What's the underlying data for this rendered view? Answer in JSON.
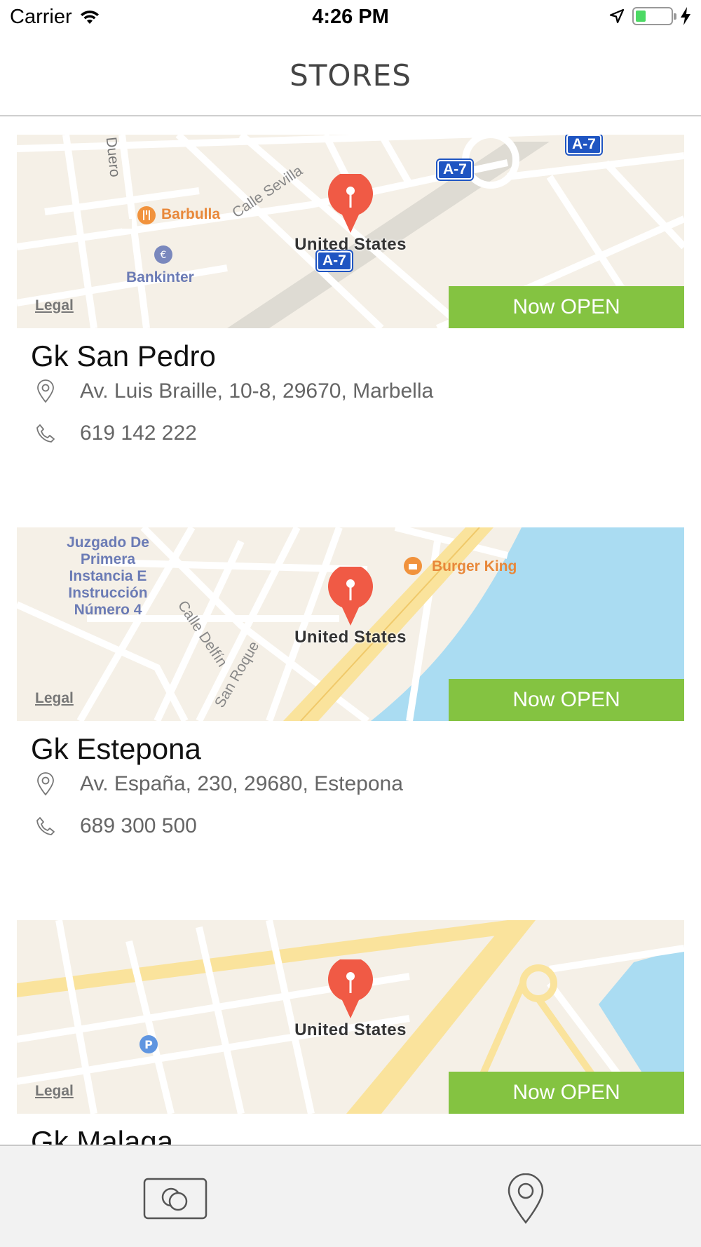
{
  "status_bar": {
    "carrier": "Carrier",
    "time": "4:26 PM"
  },
  "header": {
    "title": "STORES"
  },
  "colors": {
    "badge": "#84c341",
    "pin": "#f05a45",
    "water": "#aadcf2",
    "map_bg": "#f5f0e7"
  },
  "stores": [
    {
      "name": "Gk San Pedro",
      "address": "Av. Luis Braille, 10-8, 29670, Marbella",
      "phone": "619 142 222",
      "status": "Now OPEN",
      "map": {
        "pin_label": "United States",
        "legal": "Legal",
        "pois": [
          "Barbulla",
          "Bankinter",
          "Calle Sevilla",
          "Duero",
          "A-7",
          "A-7",
          "A-7"
        ]
      }
    },
    {
      "name": "Gk Estepona",
      "address": "Av. España, 230, 29680, Estepona",
      "phone": "689 300 500",
      "status": "Now OPEN",
      "map": {
        "pin_label": "United States",
        "legal": "Legal",
        "pois": [
          "Burger King",
          "Juzgado De Primera Instancia E Instrucción Número 4",
          "Calle Delfín",
          "San Roque"
        ]
      }
    },
    {
      "name": "Gk Malaga",
      "status": "Now OPEN",
      "map": {
        "pin_label": "United States",
        "legal": "Legal"
      }
    }
  ],
  "tab_bar": {
    "items": [
      {
        "icon": "coins-icon"
      },
      {
        "icon": "location-pin-icon"
      }
    ]
  }
}
